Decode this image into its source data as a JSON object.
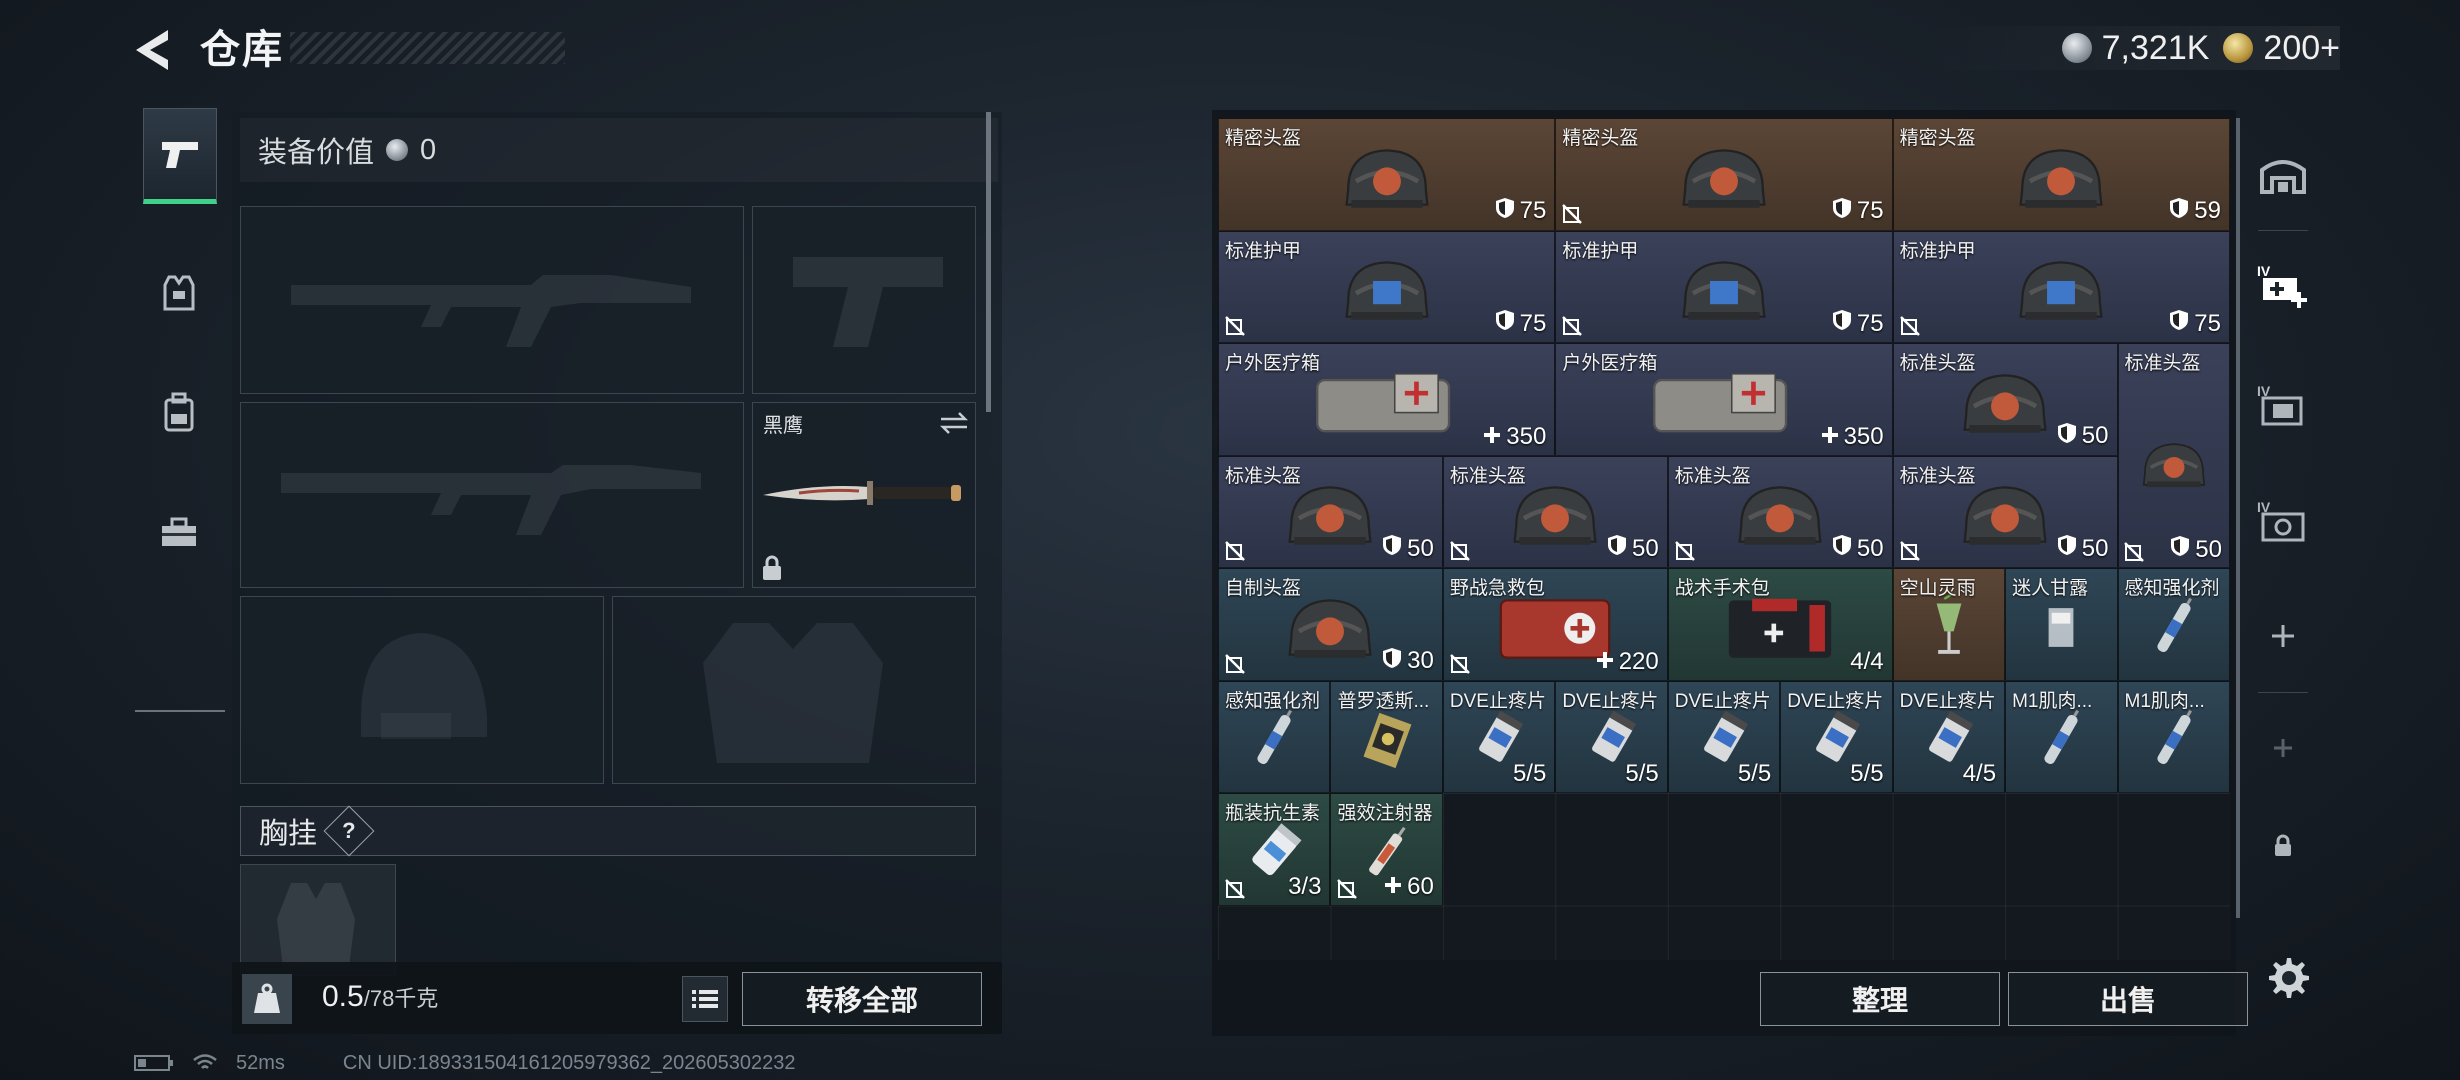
{
  "header": {
    "title": "仓库"
  },
  "currency": [
    {
      "icon": "silver-coin-icon",
      "value": "7,321K"
    },
    {
      "icon": "gold-coin-icon",
      "value": "200+"
    }
  ],
  "left_nav": [
    {
      "name": "nav-tab-weapons",
      "icon": "pistol-icon",
      "active": true
    },
    {
      "name": "nav-tab-armor",
      "icon": "vest-icon",
      "active": false
    },
    {
      "name": "nav-tab-backpack",
      "icon": "backpack-icon",
      "active": false
    },
    {
      "name": "nav-tab-toolbox",
      "icon": "toolbox-icon",
      "active": false
    }
  ],
  "equipment": {
    "value_label": "装备价值",
    "value": "0",
    "melee_label": "黑鹰",
    "chest_label": "胸挂",
    "chest_help": "?"
  },
  "weight": {
    "current": "0.5",
    "max": "/78千克"
  },
  "buttons": {
    "transfer_all": "转移全部",
    "sort": "整理",
    "sell": "出售"
  },
  "storage_items": [
    {
      "name": "精密头盔",
      "value": "75",
      "value_icon": "shield-icon",
      "nosell": false,
      "bg": "brown",
      "art": "helmet-icon"
    },
    {
      "name": "精密头盔",
      "value": "75",
      "value_icon": "shield-icon",
      "nosell": true,
      "bg": "brown",
      "art": "helmet-icon"
    },
    {
      "name": "精密头盔",
      "value": "59",
      "value_icon": "shield-icon",
      "nosell": false,
      "bg": "brown",
      "art": "helmet-icon"
    },
    {
      "name": "标准护甲",
      "value": "75",
      "value_icon": "shield-icon",
      "nosell": true,
      "bg": "blue",
      "art": "armor-icon"
    },
    {
      "name": "标准护甲",
      "value": "75",
      "value_icon": "shield-icon",
      "nosell": true,
      "bg": "blue",
      "art": "armor-icon"
    },
    {
      "name": "标准护甲",
      "value": "75",
      "value_icon": "shield-icon",
      "nosell": true,
      "bg": "blue",
      "art": "armor-icon"
    },
    {
      "name": "户外医疗箱",
      "value": "350",
      "value_icon": "plus-icon",
      "nosell": false,
      "bg": "blue",
      "art": "medkit-icon"
    },
    {
      "name": "户外医疗箱",
      "value": "350",
      "value_icon": "plus-icon",
      "nosell": false,
      "bg": "blue",
      "art": "medkit-icon"
    },
    {
      "name": "标准头盔",
      "value": "50",
      "value_icon": "shield-icon",
      "nosell": false,
      "bg": "blue",
      "art": "helmet-icon"
    },
    {
      "name": "标准头盔",
      "value": "",
      "value_icon": "",
      "nosell": false,
      "bg": "blue",
      "art": "helmet-icon"
    },
    {
      "name": "标准头盔",
      "value": "50",
      "value_icon": "shield-icon",
      "nosell": true,
      "bg": "blue",
      "art": "helmet-icon"
    },
    {
      "name": "标准头盔",
      "value": "50",
      "value_icon": "shield-icon",
      "nosell": true,
      "bg": "blue",
      "art": "helmet-icon"
    },
    {
      "name": "标准头盔",
      "value": "50",
      "value_icon": "shield-icon",
      "nosell": true,
      "bg": "blue",
      "art": "helmet-icon"
    },
    {
      "name": "标准头盔",
      "value": "50",
      "value_icon": "shield-icon",
      "nosell": true,
      "bg": "blue",
      "art": "helmet-icon"
    },
    {
      "name": "",
      "value": "50",
      "value_icon": "shield-icon",
      "nosell": true,
      "bg": "blue",
      "art": ""
    },
    {
      "name": "自制头盔",
      "value": "30",
      "value_icon": "shield-icon",
      "nosell": true,
      "bg": "teal",
      "art": "helmet-icon"
    },
    {
      "name": "野战急救包",
      "value": "220",
      "value_icon": "plus-icon",
      "nosell": true,
      "bg": "teal",
      "art": "first-aid-kit-icon"
    },
    {
      "name": "战术手术包",
      "value": "4/4",
      "value_icon": "",
      "nosell": false,
      "bg": "green",
      "art": "surgery-kit-icon"
    },
    {
      "name": "空山灵雨",
      "value": "",
      "value_icon": "",
      "nosell": false,
      "bg": "brown",
      "art": "cocktail-icon"
    },
    {
      "name": "迷人甘露",
      "value": "",
      "value_icon": "",
      "nosell": false,
      "bg": "teal",
      "art": "glass-icon"
    },
    {
      "name": "感知强化剂",
      "value": "",
      "value_icon": "",
      "nosell": false,
      "bg": "teal",
      "art": "injector-icon"
    },
    {
      "name": "感知强化剂",
      "value": "",
      "value_icon": "",
      "nosell": false,
      "bg": "teal",
      "art": "injector-icon"
    },
    {
      "name": "普罗透斯...",
      "value": "",
      "value_icon": "",
      "nosell": false,
      "bg": "teal",
      "art": "pack-icon"
    },
    {
      "name": "DVE止疼片",
      "value": "5/5",
      "value_icon": "",
      "nosell": false,
      "bg": "teal",
      "art": "pill-bottle-icon"
    },
    {
      "name": "DVE止疼片",
      "value": "5/5",
      "value_icon": "",
      "nosell": false,
      "bg": "teal",
      "art": "pill-bottle-icon"
    },
    {
      "name": "DVE止疼片",
      "value": "5/5",
      "value_icon": "",
      "nosell": false,
      "bg": "teal",
      "art": "pill-bottle-icon"
    },
    {
      "name": "DVE止疼片",
      "value": "5/5",
      "value_icon": "",
      "nosell": false,
      "bg": "teal",
      "art": "pill-bottle-icon"
    },
    {
      "name": "DVE止疼片",
      "value": "4/5",
      "value_icon": "",
      "nosell": false,
      "bg": "teal",
      "art": "pill-bottle-icon"
    },
    {
      "name": "M1肌肉...",
      "value": "",
      "value_icon": "",
      "nosell": false,
      "bg": "teal",
      "art": "injector-icon"
    },
    {
      "name": "M1肌肉...",
      "value": "",
      "value_icon": "",
      "nosell": false,
      "bg": "teal",
      "art": "injector-icon"
    },
    {
      "name": "瓶装抗生素",
      "value": "3/3",
      "value_icon": "",
      "nosell": true,
      "bg": "green",
      "art": "antibiotic-bottle-icon"
    },
    {
      "name": "强效注射器",
      "value": "60",
      "value_icon": "plus-icon",
      "nosell": true,
      "bg": "green",
      "art": "syringe-icon"
    }
  ],
  "status_bar": {
    "ping": "52ms",
    "uid": "CN UID:189331504161205979362_202605302232"
  },
  "colors": {
    "accent_green": "#3fd08a",
    "slot_border": "#3b4650",
    "brown_item": "#5b4636",
    "blue_item": "#3a4159",
    "teal_item": "#2f4656",
    "green_item": "#2d4a44"
  }
}
